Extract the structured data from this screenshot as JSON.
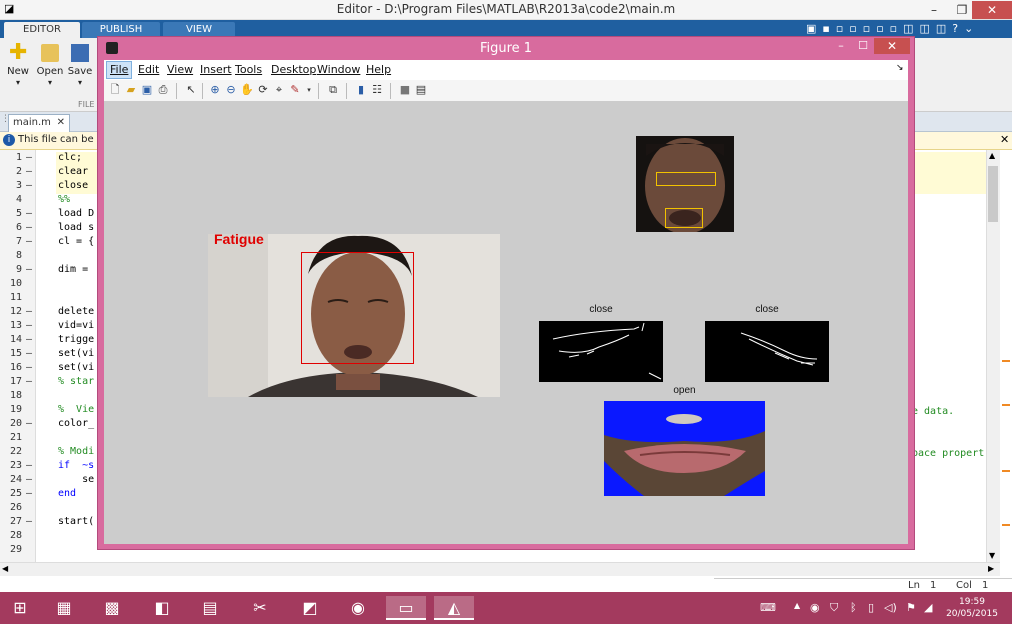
{
  "editor": {
    "title": "Editor - D:\\Program Files\\MATLAB\\R2013a\\code2\\main.m",
    "ribbon_tabs": [
      "EDITOR",
      "PUBLISH",
      "VIEW"
    ],
    "ribbon_buttons": [
      "New",
      "Open",
      "Save"
    ],
    "ribbon_section": "FILE",
    "document_tab": "main.m",
    "banner": "This file can be pul",
    "lines": [
      {
        "n": "1",
        "dash": "–",
        "code": "clc;",
        "cls": ""
      },
      {
        "n": "2",
        "dash": "–",
        "code": "clear",
        "cls": ""
      },
      {
        "n": "3",
        "dash": "–",
        "code": "close",
        "cls": ""
      },
      {
        "n": "4",
        "dash": "",
        "code": "%%",
        "cls": "cmt"
      },
      {
        "n": "5",
        "dash": "–",
        "code": "load D",
        "cls": ""
      },
      {
        "n": "6",
        "dash": "–",
        "code": "load s",
        "cls": ""
      },
      {
        "n": "7",
        "dash": "–",
        "code": "cl = {",
        "cls": ""
      },
      {
        "n": "8",
        "dash": "",
        "code": "",
        "cls": ""
      },
      {
        "n": "9",
        "dash": "–",
        "code": "dim =",
        "cls": ""
      },
      {
        "n": "10",
        "dash": "",
        "code": "",
        "cls": ""
      },
      {
        "n": "11",
        "dash": "",
        "code": "",
        "cls": ""
      },
      {
        "n": "12",
        "dash": "–",
        "code": "delete",
        "cls": ""
      },
      {
        "n": "13",
        "dash": "–",
        "code": "vid=vi",
        "cls": ""
      },
      {
        "n": "14",
        "dash": "–",
        "code": "trigge",
        "cls": ""
      },
      {
        "n": "15",
        "dash": "–",
        "code": "set(vi",
        "cls": ""
      },
      {
        "n": "16",
        "dash": "–",
        "code": "set(vi",
        "cls": ""
      },
      {
        "n": "17",
        "dash": "–",
        "code": "% star",
        "cls": "cmt"
      },
      {
        "n": "18",
        "dash": "",
        "code": "",
        "cls": ""
      },
      {
        "n": "19",
        "dash": "",
        "code": "%  Vie",
        "cls": "cmt"
      },
      {
        "n": "20",
        "dash": "–",
        "code": "color_",
        "cls": ""
      },
      {
        "n": "21",
        "dash": "",
        "code": "",
        "cls": ""
      },
      {
        "n": "22",
        "dash": "",
        "code": "% Modi",
        "cls": "cmt"
      },
      {
        "n": "23",
        "dash": "–",
        "code": "if  ~s",
        "cls": "kw"
      },
      {
        "n": "24",
        "dash": "–",
        "code": "    se",
        "cls": ""
      },
      {
        "n": "25",
        "dash": "–",
        "code": "end",
        "cls": "kw"
      },
      {
        "n": "26",
        "dash": "",
        "code": "",
        "cls": ""
      },
      {
        "n": "27",
        "dash": "–",
        "code": "start(",
        "cls": ""
      },
      {
        "n": "28",
        "dash": "",
        "code": "",
        "cls": ""
      },
      {
        "n": "29",
        "dash": "",
        "code": "",
        "cls": ""
      }
    ],
    "right_code_19": "e data.",
    "right_code_22": "pace propert",
    "status_ln_label": "Ln",
    "status_ln": "1",
    "status_col_label": "Col",
    "status_col": "1"
  },
  "figure": {
    "title": "Figure 1",
    "menus": [
      "File",
      "Edit",
      "View",
      "Insert",
      "Tools",
      "Desktop",
      "Window",
      "Help"
    ],
    "fatigue_label": "Fatigue",
    "left_eye_title": "close",
    "right_eye_title": "close",
    "mouth_title": "open"
  },
  "taskbar": {
    "time": "19:59",
    "date": "20/05/2015"
  }
}
